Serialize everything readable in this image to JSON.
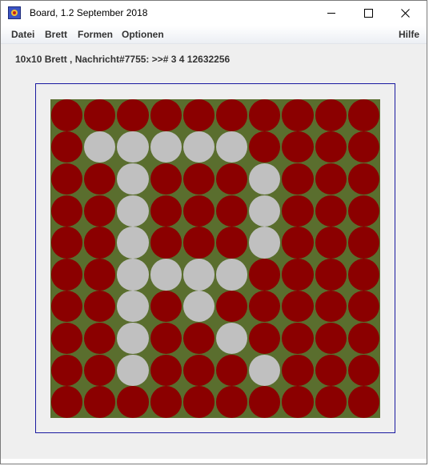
{
  "window": {
    "title": "Board, 1.2 September 2018",
    "icon": "board-app-icon",
    "controls": [
      "minimize-icon",
      "maximize-icon",
      "close-icon"
    ]
  },
  "menu": {
    "left": [
      "Datei",
      "Brett",
      "Formen",
      "Optionen"
    ],
    "help": "Hilfe"
  },
  "status_text": "10x10 Brett , Nachricht#7755: >># 3 4 12632256",
  "board": {
    "rows": 10,
    "cols": 10,
    "colors": {
      "background": "#5a6e2e",
      "default": "#8b0000",
      "highlight": "#c0c0c0",
      "frame": "#1a1aa0"
    },
    "grid": [
      "0000000000",
      "0111110000",
      "0010001000",
      "0010001000",
      "0010001000",
      "0011110000",
      "0010100000",
      "0010010000",
      "0010001000",
      "0000000000"
    ]
  }
}
